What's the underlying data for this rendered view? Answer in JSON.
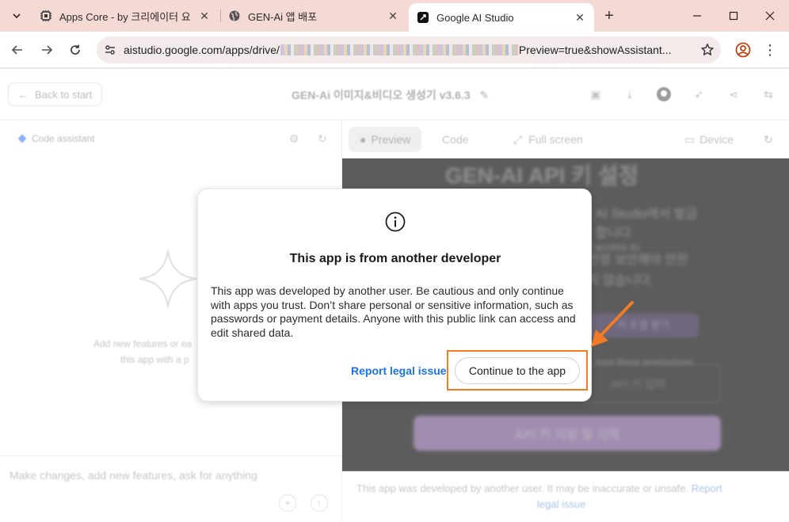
{
  "browser": {
    "tabs": [
      {
        "title": "Apps Core - by 크리에이터 요",
        "icon": "chip-icon",
        "active": false
      },
      {
        "title": "GEN-Ai 앱 배포",
        "icon": "globe-icon",
        "active": false
      },
      {
        "title": "Google AI Studio",
        "icon": "ai-studio-icon",
        "active": true
      }
    ],
    "url_host": "aistudio.google.com/apps/drive/",
    "url_tail": "Preview=true&showAssistant..."
  },
  "app": {
    "back_label": "Back to start",
    "title": "GEN-Ai 이미지&비디오 생성기 v3.6.3",
    "code_assistant_label": "Code assistant",
    "left_hint_line1": "Add new features or ea",
    "left_hint_line2": "this app with a p",
    "composer_placeholder": "Make changes, add new features, ask for anything",
    "right_tabs": {
      "preview": "Preview",
      "code": "Code",
      "full_screen": "Full screen",
      "device": "Device"
    },
    "preview_title": "GEN-AI API 키 설정",
    "preview_lines": [
      "AI Studio에서 발급",
      "합니다.",
      "ll access to:",
      "안정 보안해야 안전",
      "지 않습니다.",
      "hout these permissions."
    ],
    "preview_chip": "키 조결 받기",
    "preview_button": "API 키 저장 및 시작",
    "preview_field_placeholder": "API 키 입력",
    "footer_text": "This app was developed by another user. It may be inaccurate or unsafe.",
    "footer_link_1": "Report",
    "footer_link_2": "legal issue"
  },
  "dialog": {
    "title": "This app is from another developer",
    "body": "This app was developed by another user. Be cautious and only continue with apps you trust. Don’t share personal or sensitive information, such as passwords or payment details. Anyone with this public link can access and edit shared data.",
    "report_label": "Report legal issue",
    "continue_label": "Continue to the app"
  },
  "colors": {
    "tabbar_bg": "#f5d9d4",
    "link_blue": "#1a73e8",
    "annotation_orange": "#f07b24",
    "preview_button": "#d7b8f0"
  }
}
